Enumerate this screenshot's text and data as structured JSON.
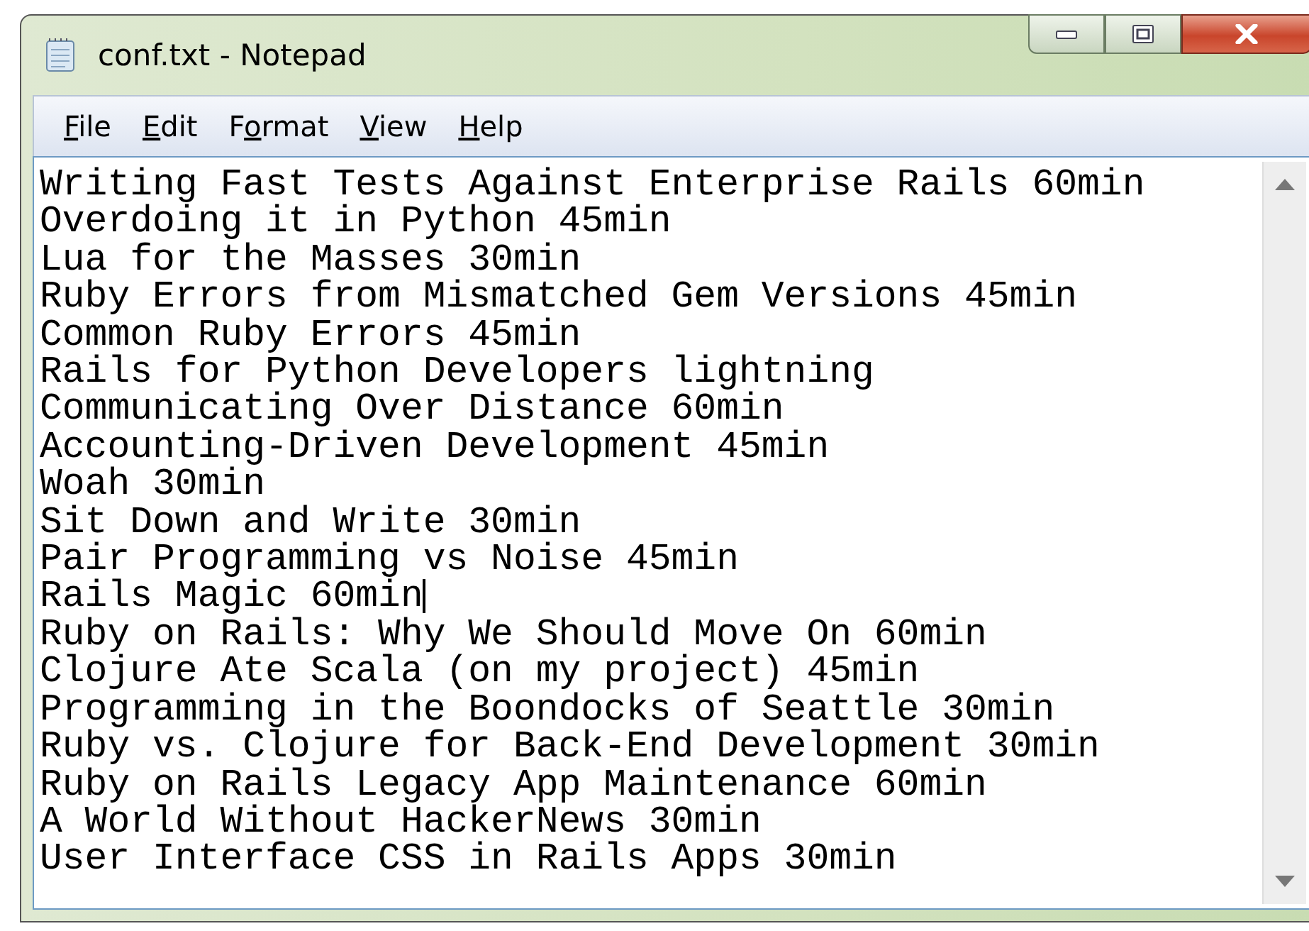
{
  "window": {
    "title": "conf.txt - Notepad"
  },
  "menu": [
    {
      "access_key": "F",
      "rest": "ile"
    },
    {
      "access_key": "E",
      "rest": "dit"
    },
    {
      "lead": "F",
      "access_key": "o",
      "rest": "rmat"
    },
    {
      "access_key": "V",
      "rest": "iew"
    },
    {
      "access_key": "H",
      "rest": "elp"
    }
  ],
  "lines": [
    {
      "text": "Writing Fast Tests Against Enterprise Rails 60min",
      "caret": false
    },
    {
      "text": "Overdoing it in Python 45min",
      "caret": false
    },
    {
      "text": "Lua for the Masses 30min",
      "caret": false
    },
    {
      "text": "Ruby Errors from Mismatched Gem Versions 45min",
      "caret": false
    },
    {
      "text": "Common Ruby Errors 45min",
      "caret": false
    },
    {
      "text": "Rails for Python Developers lightning",
      "caret": false
    },
    {
      "text": "Communicating Over Distance 60min",
      "caret": false
    },
    {
      "text": "Accounting-Driven Development 45min",
      "caret": false
    },
    {
      "text": "Woah 30min",
      "caret": false
    },
    {
      "text": "Sit Down and Write 30min",
      "caret": false
    },
    {
      "text": "Pair Programming vs Noise 45min",
      "caret": false
    },
    {
      "text": "Rails Magic 60min",
      "caret": true
    },
    {
      "text": "Ruby on Rails: Why We Should Move On 60min",
      "caret": false
    },
    {
      "text": "Clojure Ate Scala (on my project) 45min",
      "caret": false
    },
    {
      "text": "Programming in the Boondocks of Seattle 30min",
      "caret": false
    },
    {
      "text": "Ruby vs. Clojure for Back-End Development 30min",
      "caret": false
    },
    {
      "text": "Ruby on Rails Legacy App Maintenance 60min",
      "caret": false
    },
    {
      "text": "A World Without HackerNews 30min",
      "caret": false
    },
    {
      "text": "User Interface CSS in Rails Apps 30min",
      "caret": false
    }
  ]
}
